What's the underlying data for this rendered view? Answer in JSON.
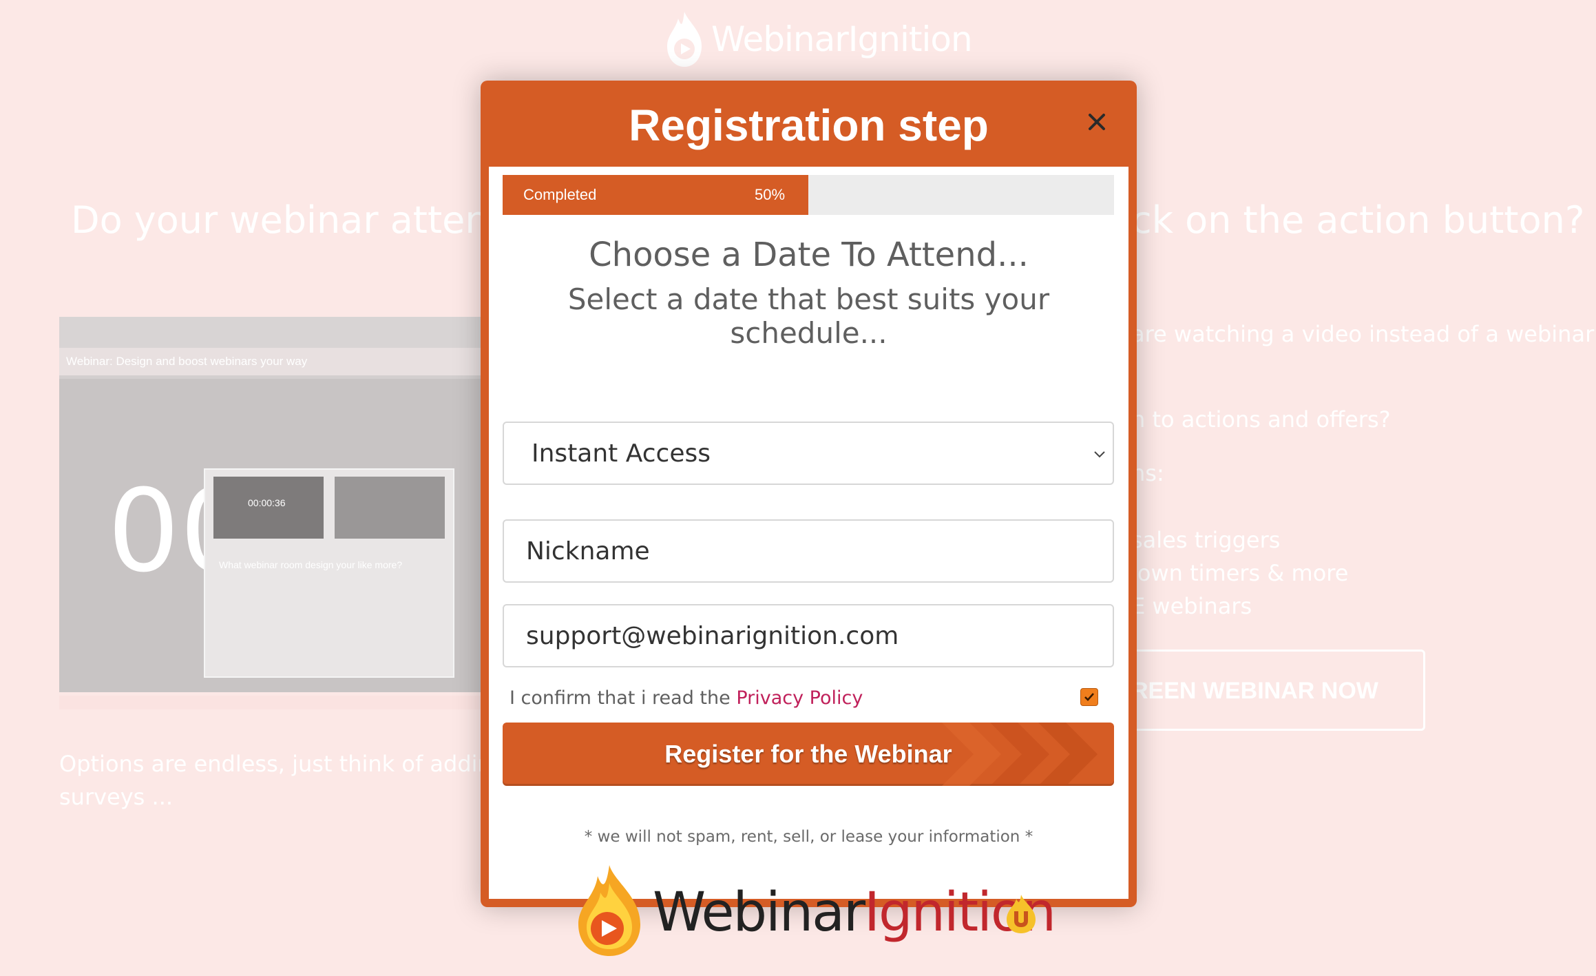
{
  "background": {
    "logo_text": "WebinarIgnition",
    "headline_left": "Do your webinar attende",
    "headline_right": "ck on the action button?",
    "preview_bar": "Webinar: Design and boost webinars your way",
    "preview_clock": "00",
    "preview_timer": "00:00:36",
    "preview_question": "What webinar room design your like more?",
    "right_lines": [
      "are watching a video instead of a webinar",
      "n to actions and offers?",
      "ns:",
      "sales triggers",
      "lown timers & more",
      "E webinars"
    ],
    "cta_partial": "REEN WEBINAR NOW",
    "bottom_left_1": "Options are endless, just think of adding p",
    "bottom_left_2": "surveys ..."
  },
  "modal": {
    "title": "Registration step",
    "close_icon": "close-icon",
    "progress": {
      "label": "Completed",
      "percent_text": "50%",
      "value": 0.5,
      "color": "#d55c25"
    },
    "heading": "Choose a Date To Attend...",
    "subheading": "Select a date that best suits your schedule...",
    "date_select": {
      "selected": "Instant Access"
    },
    "nickname_placeholder": "Nickname",
    "email_value": "support@webinarignition.com",
    "confirm_text": "I confirm that i read the ",
    "privacy_link": "Privacy Policy",
    "confirm_checked": true,
    "register_label": "Register for the Webinar",
    "spam_notice": "* we will not spam, rent, sell, or lease your information *",
    "brand": {
      "part1": "Webinar",
      "part2": "Ignition"
    }
  },
  "colors": {
    "accent": "#d55c25",
    "background": "#fce8e6",
    "link": "#c0205a"
  }
}
